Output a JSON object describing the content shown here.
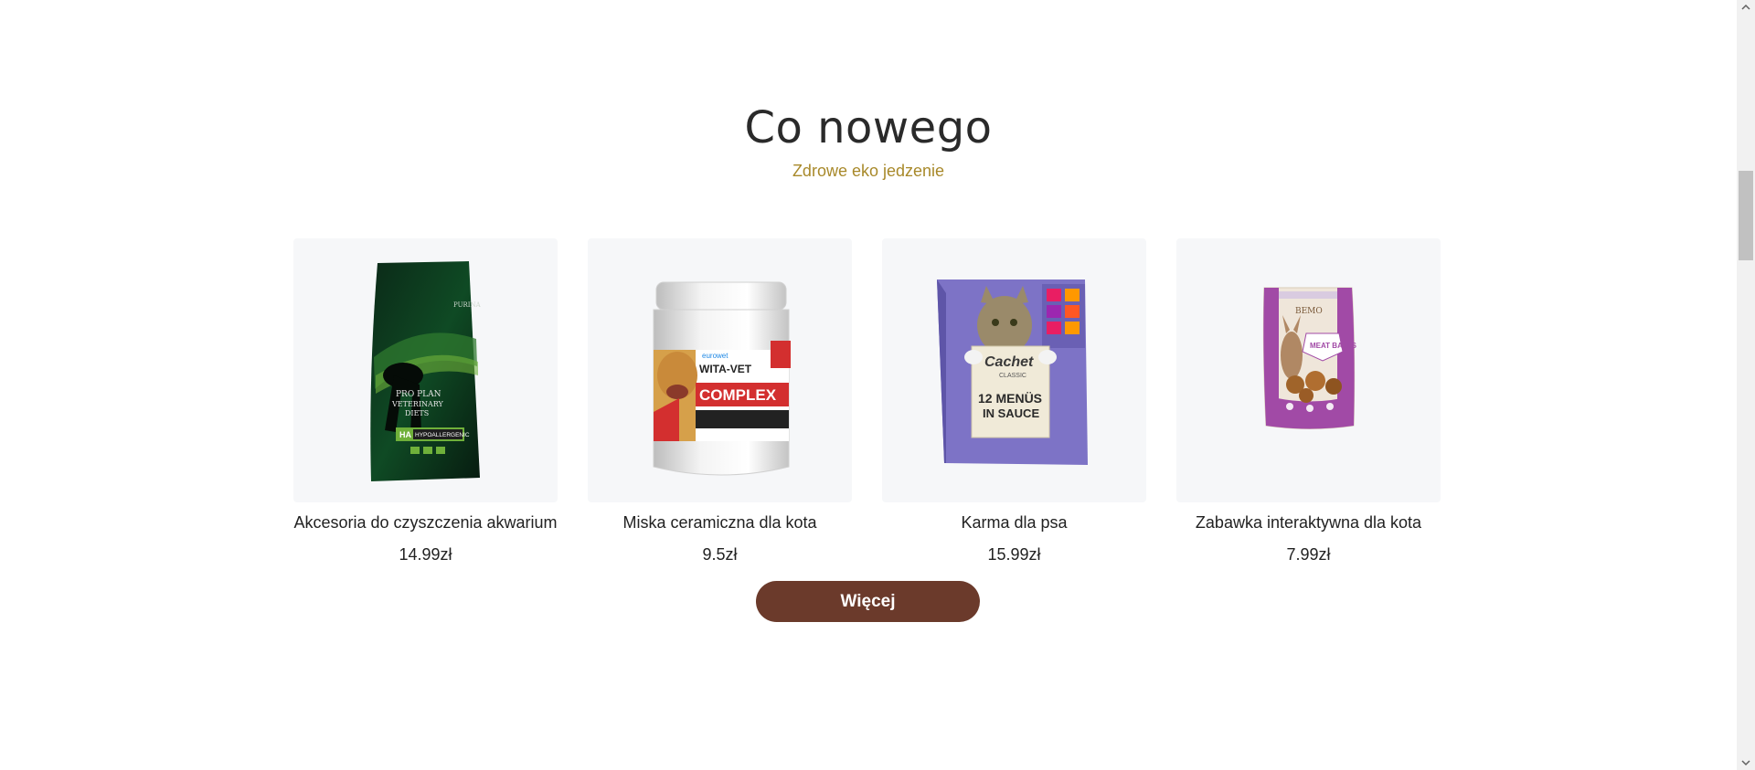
{
  "section": {
    "title": "Co nowego",
    "subtitle": "Zdrowe eko jedzenie"
  },
  "products": [
    {
      "name": "Akcesoria do czyszczenia akwarium",
      "price": "14.99zł",
      "image_icon": "dog-food-bag-icon",
      "image_text": [
        "PURINA",
        "PRO PLAN",
        "VETERINARY",
        "DIETS",
        "HA",
        "HYPOALLERGENIC"
      ]
    },
    {
      "name": "Miska ceramiczna dla kota",
      "price": "9.5zł",
      "image_icon": "supplement-jar-icon",
      "image_text": [
        "eurowet",
        "WITA-VET",
        "COMPLEX"
      ]
    },
    {
      "name": "Karma dla psa",
      "price": "15.99zł",
      "image_icon": "cat-food-box-icon",
      "image_text": [
        "Cachet",
        "CLASSIC",
        "12 MENÜS",
        "IN SAUCE"
      ]
    },
    {
      "name": "Zabawka interaktywna dla kota",
      "price": "7.99zł",
      "image_icon": "treat-pouch-icon",
      "image_text": [
        "BEMO",
        "MEAT BALLS"
      ]
    }
  ],
  "more_button": {
    "label": "Więcej"
  },
  "colors": {
    "accent_gold": "#a8892a",
    "button_brown": "#6b3a2b",
    "card_bg": "#f6f7f9"
  }
}
